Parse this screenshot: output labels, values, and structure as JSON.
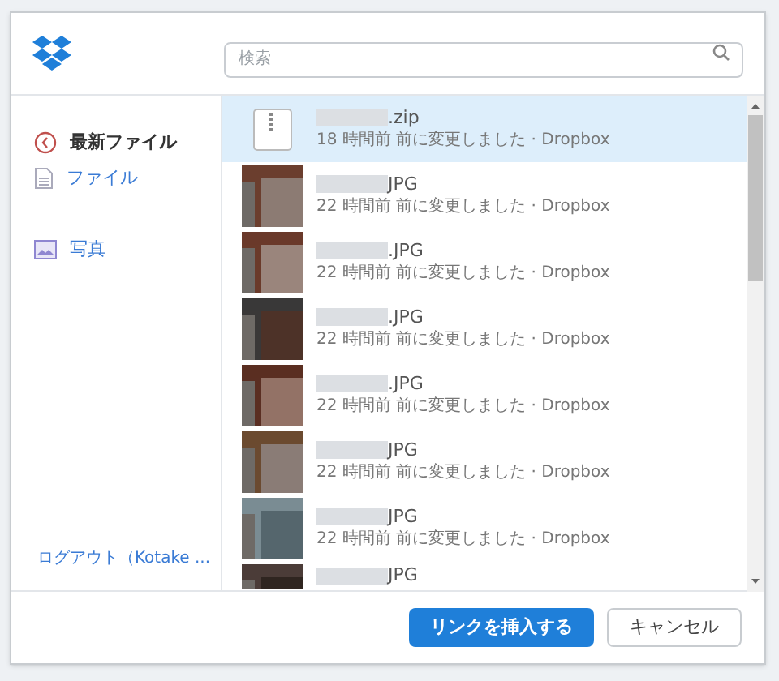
{
  "search": {
    "placeholder": "検索"
  },
  "sidebar": {
    "items": [
      {
        "kind": "recent",
        "label": "最新ファイル",
        "selected": true
      },
      {
        "kind": "files",
        "label": "ファイル",
        "selected": false
      },
      {
        "kind": "photos",
        "label": "写真",
        "selected": false
      }
    ],
    "logout": "ログアウト（Kotake ..."
  },
  "files": [
    {
      "kind": "zip",
      "name": ".zip",
      "meta": "18 時間前 前に変更しました · Dropbox",
      "selected": true
    },
    {
      "name": "JPG",
      "meta": "22 時間前 前に変更しました · Dropbox",
      "selected": false
    },
    {
      "name": ".JPG",
      "meta": "22 時間前 前に変更しました · Dropbox",
      "selected": false
    },
    {
      "name": ".JPG",
      "meta": "22 時間前 前に変更しました · Dropbox",
      "selected": false
    },
    {
      "name": ".JPG",
      "meta": "22 時間前 前に変更しました · Dropbox",
      "selected": false
    },
    {
      "name": "JPG",
      "meta": "22 時間前 前に変更しました · Dropbox",
      "selected": false
    },
    {
      "name": "JPG",
      "meta": "22 時間前 前に変更しました · Dropbox",
      "selected": false
    },
    {
      "name": "JPG",
      "selected": false
    }
  ],
  "buttons": [
    {
      "kind": "primary",
      "label": "リンクを挿入する"
    },
    {
      "kind": "secondary",
      "label": "キャンセル"
    }
  ]
}
